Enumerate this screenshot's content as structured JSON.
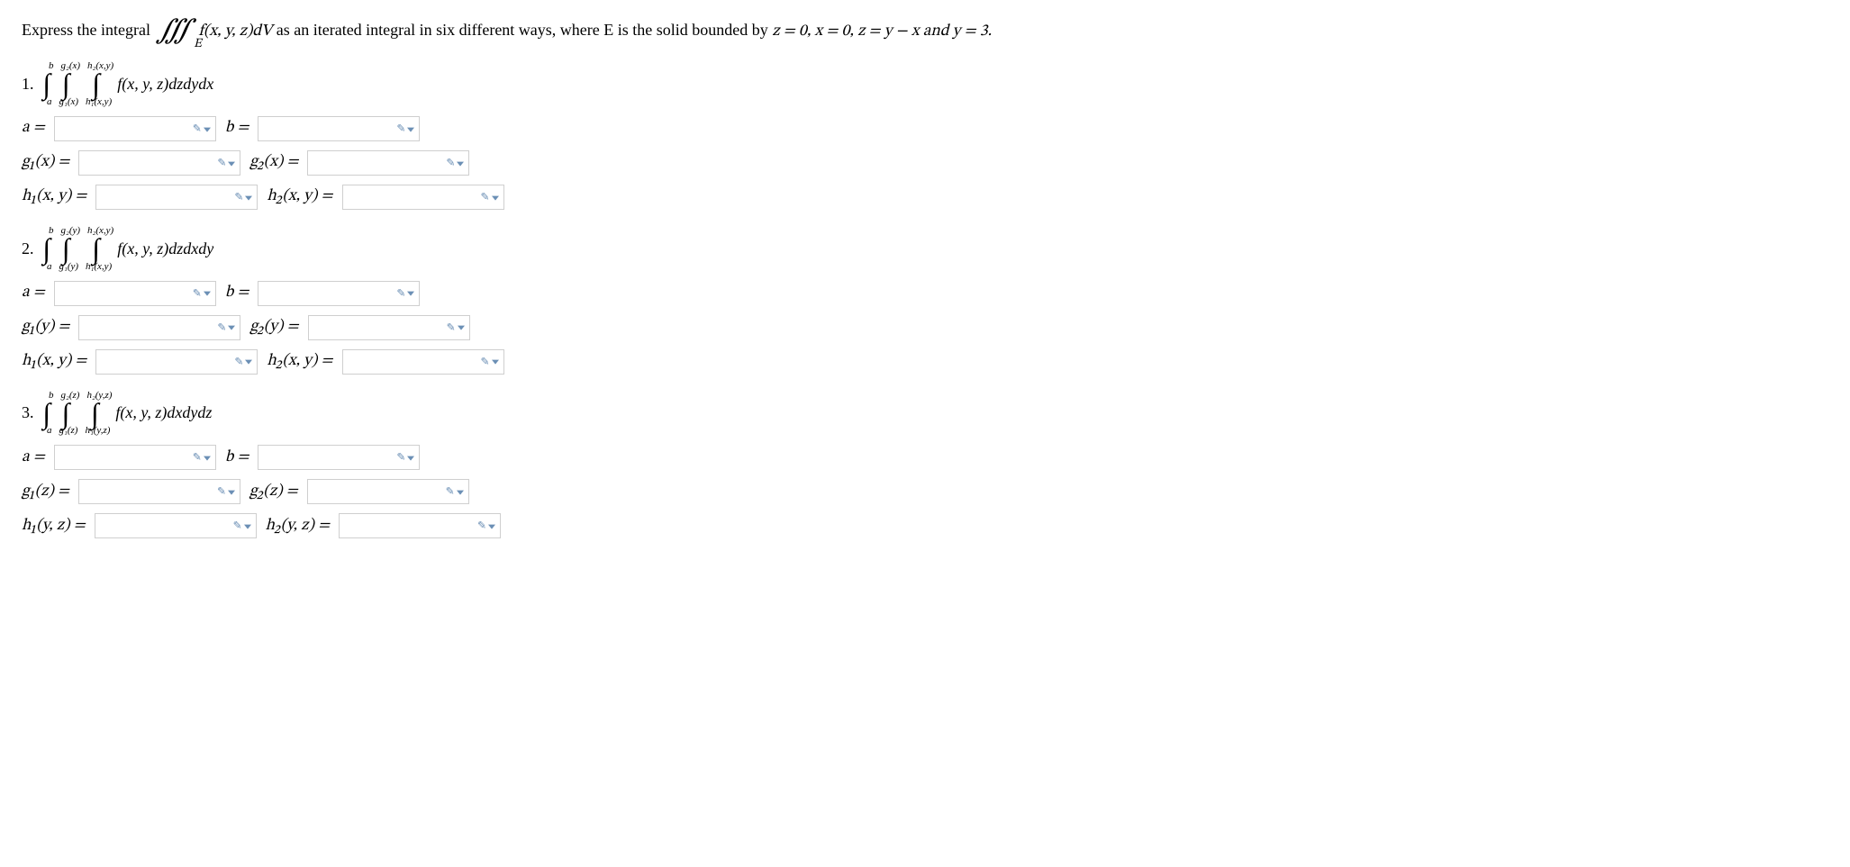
{
  "prompt": {
    "before": "Express the integral ",
    "integrand": "f(x, y, z)dV",
    "after": " as an iterated integral in six different ways, where E is the solid bounded by ",
    "bounds": "z = 0, x = 0, z = y − x and y = 3.",
    "E": "E"
  },
  "sections": [
    {
      "num": "1.",
      "limits": [
        {
          "sup": "b",
          "sub": "a"
        },
        {
          "sup": "g₂(x)",
          "sub": "g₁(x)"
        },
        {
          "sup": "h₂(x,y)",
          "sub": "h₁(x,y)"
        }
      ],
      "integrand": "f(x, y, z)dzdydx",
      "rows": [
        [
          {
            "label": "a =",
            "name": "p1-a"
          },
          {
            "label": "b =",
            "name": "p1-b"
          }
        ],
        [
          {
            "label": "g₁(x) =",
            "name": "p1-g1"
          },
          {
            "label": "g₂(x) =",
            "name": "p1-g2"
          }
        ],
        [
          {
            "label": "h₁(x, y) =",
            "name": "p1-h1"
          },
          {
            "label": "h₂(x, y) =",
            "name": "p1-h2"
          }
        ]
      ]
    },
    {
      "num": "2.",
      "limits": [
        {
          "sup": "b",
          "sub": "a"
        },
        {
          "sup": "g₂(y)",
          "sub": "g₁(y)"
        },
        {
          "sup": "h₂(x,y)",
          "sub": "h₁(x,y)"
        }
      ],
      "integrand": "f(x, y, z)dzdxdy",
      "rows": [
        [
          {
            "label": "a =",
            "name": "p2-a"
          },
          {
            "label": "b =",
            "name": "p2-b"
          }
        ],
        [
          {
            "label": "g₁(y) =",
            "name": "p2-g1"
          },
          {
            "label": "g₂(y) =",
            "name": "p2-g2"
          }
        ],
        [
          {
            "label": "h₁(x, y) =",
            "name": "p2-h1"
          },
          {
            "label": "h₂(x, y) =",
            "name": "p2-h2"
          }
        ]
      ]
    },
    {
      "num": "3.",
      "limits": [
        {
          "sup": "b",
          "sub": "a"
        },
        {
          "sup": "g₂(z)",
          "sub": "g₁(z)"
        },
        {
          "sup": "h₂(y,z)",
          "sub": "h₁(y,z)"
        }
      ],
      "integrand": "f(x, y, z)dxdydz",
      "rows": [
        [
          {
            "label": "a =",
            "name": "p3-a"
          },
          {
            "label": "b =",
            "name": "p3-b"
          }
        ],
        [
          {
            "label": "g₁(z) =",
            "name": "p3-g1"
          },
          {
            "label": "g₂(z) =",
            "name": "p3-g2"
          }
        ],
        [
          {
            "label": "h₁(y, z) =",
            "name": "p3-h1"
          },
          {
            "label": "h₂(y, z) =",
            "name": "p3-h2"
          }
        ]
      ]
    }
  ]
}
